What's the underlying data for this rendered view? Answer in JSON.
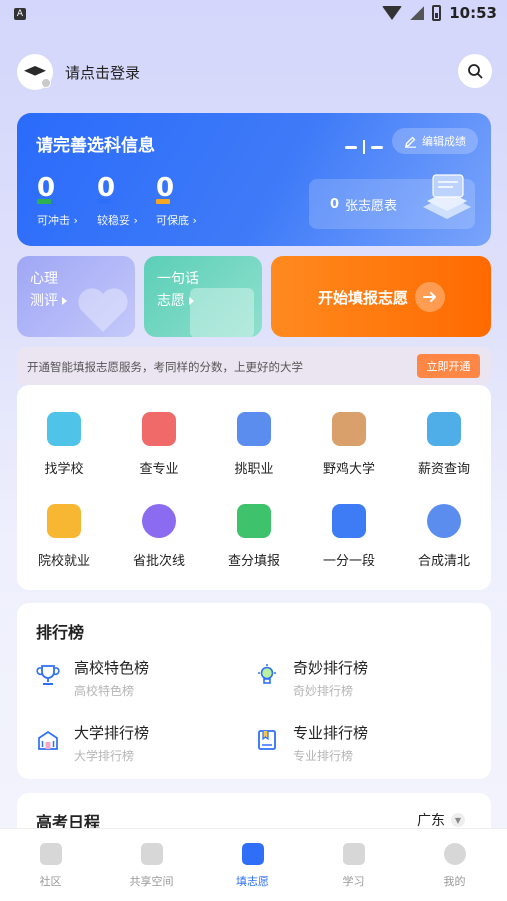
{
  "status_bar": {
    "time": "10:53",
    "app_badge": "A"
  },
  "header": {
    "login_prompt": "请点击登录"
  },
  "score_card": {
    "title": "请完善选科信息",
    "edit_label": "编辑成绩",
    "stats": [
      {
        "value": "0",
        "label": "可冲击",
        "color": "#2bb14f"
      },
      {
        "value": "0",
        "label": "较稳妥",
        "color": "#2f6ff7"
      },
      {
        "value": "0",
        "label": "可保底",
        "color": "#f5a623"
      }
    ],
    "wish_count": "0",
    "wish_label": "张志愿表"
  },
  "tiles": {
    "psy_line1": "心理",
    "psy_line2": "测评",
    "wish_line1": "一句话",
    "wish_line2": "志愿",
    "start_label": "开始填报志愿"
  },
  "promo": {
    "text": "开通智能填报志愿服务，考同样的分数，上更好的大学",
    "button": "立即开通"
  },
  "features": [
    {
      "label": "找学校",
      "icon": "school-icon",
      "color": "#4fc3e8"
    },
    {
      "label": "查专业",
      "icon": "major-icon",
      "color": "#f06a6a"
    },
    {
      "label": "挑职业",
      "icon": "career-icon",
      "color": "#5b8def"
    },
    {
      "label": "野鸡大学",
      "icon": "chicken-icon",
      "color": "#d9a06b"
    },
    {
      "label": "薪资查询",
      "icon": "salary-icon",
      "color": "#4faee8"
    },
    {
      "label": "院校就业",
      "icon": "employment-icon",
      "color": "#f7b733"
    },
    {
      "label": "省批次线",
      "icon": "batch-line-icon",
      "color": "#8b6cf0"
    },
    {
      "label": "查分填报",
      "icon": "score-fill-icon",
      "color": "#3ec26b"
    },
    {
      "label": "一分一段",
      "icon": "segment-icon",
      "color": "#3d7cf5"
    },
    {
      "label": "合成清北",
      "icon": "qingbei-icon",
      "color": "#5b8def"
    }
  ],
  "ranking": {
    "title": "排行榜",
    "items": [
      {
        "title": "高校特色榜",
        "subtitle": "高校特色榜",
        "icon": "trophy-icon"
      },
      {
        "title": "奇妙排行榜",
        "subtitle": "奇妙排行榜",
        "icon": "bulb-icon"
      },
      {
        "title": "大学排行榜",
        "subtitle": "大学排行榜",
        "icon": "university-icon"
      },
      {
        "title": "专业排行榜",
        "subtitle": "专业排行榜",
        "icon": "book-icon"
      }
    ]
  },
  "schedule": {
    "title": "高考日程",
    "region": "广东"
  },
  "bottom_nav": [
    {
      "label": "社区",
      "icon": "community-icon"
    },
    {
      "label": "共享空间",
      "icon": "shared-space-icon"
    },
    {
      "label": "填志愿",
      "icon": "fill-wish-icon"
    },
    {
      "label": "学习",
      "icon": "study-icon"
    },
    {
      "label": "我的",
      "icon": "profile-icon"
    }
  ],
  "colors": {
    "primary": "#2f6ff7",
    "accent_orange": "#ff6a00"
  }
}
